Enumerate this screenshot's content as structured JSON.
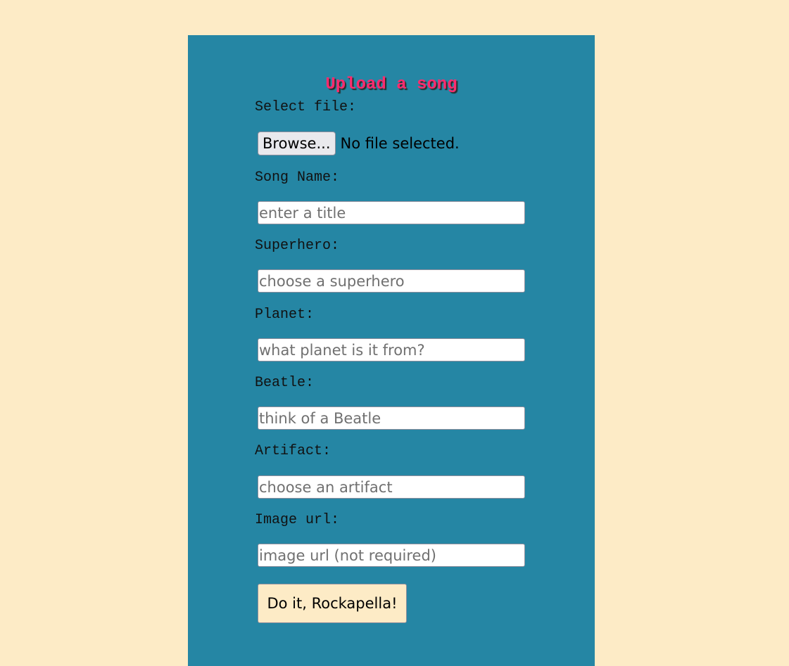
{
  "form": {
    "title": "Upload a song",
    "file": {
      "label": "Select file:",
      "browse_label": "Browse...",
      "status": "No file selected."
    },
    "song_name": {
      "label": "Song Name:",
      "placeholder": "enter a title",
      "value": ""
    },
    "superhero": {
      "label": "Superhero:",
      "placeholder": "choose a superhero",
      "value": ""
    },
    "planet": {
      "label": "Planet:",
      "placeholder": "what planet is it from?",
      "value": ""
    },
    "beatle": {
      "label": "Beatle:",
      "placeholder": "think of a Beatle",
      "value": ""
    },
    "artifact": {
      "label": "Artifact:",
      "placeholder": "choose an artifact",
      "value": ""
    },
    "image_url": {
      "label": "Image url:",
      "placeholder": "image url (not required)",
      "value": ""
    },
    "submit_label": "Do it, Rockapella!"
  },
  "colors": {
    "page_background": "#fdebc6",
    "panel_background": "#2586a4",
    "title_color": "#ff2b6e",
    "submit_background": "#fdebc6"
  }
}
